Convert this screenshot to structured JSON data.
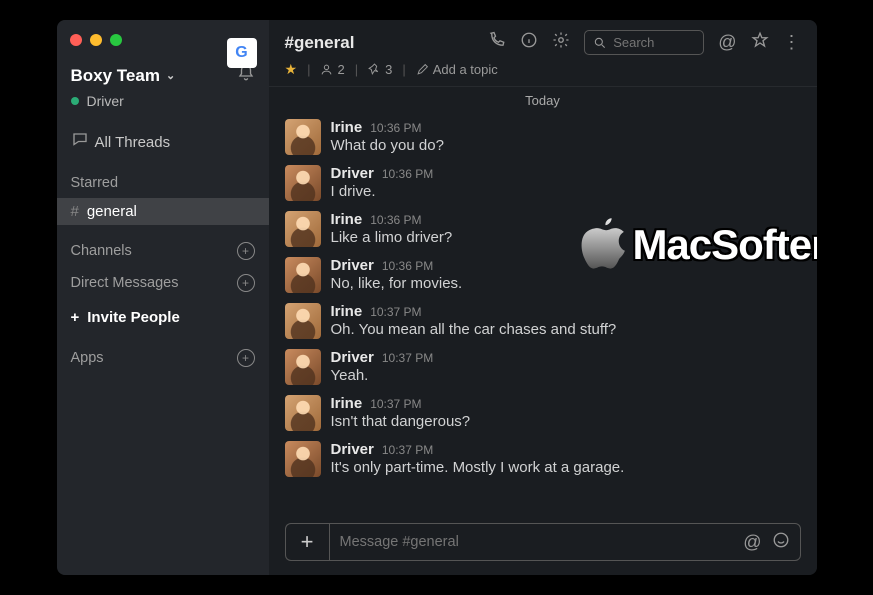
{
  "sidebar": {
    "team_name": "Boxy Team",
    "current_user": "Driver",
    "all_threads": "All Threads",
    "starred_label": "Starred",
    "channels_label": "Channels",
    "dm_label": "Direct Messages",
    "invite_label": "Invite People",
    "apps_label": "Apps",
    "starred_items": [
      {
        "name": "general",
        "active": true
      }
    ]
  },
  "header": {
    "channel_title": "#general",
    "members_count": "2",
    "pins_count": "3",
    "add_topic": "Add a topic",
    "search_placeholder": "Search"
  },
  "date_divider": "Today",
  "messages": [
    {
      "user": "Irine",
      "time": "10:36 PM",
      "text": "What do you do?"
    },
    {
      "user": "Driver",
      "time": "10:36 PM",
      "text": "I drive."
    },
    {
      "user": "Irine",
      "time": "10:36 PM",
      "text": "Like a limo driver?"
    },
    {
      "user": "Driver",
      "time": "10:36 PM",
      "text": "No, like, for movies."
    },
    {
      "user": "Irine",
      "time": "10:37 PM",
      "text": "Oh. You mean all the car chases and stuff?"
    },
    {
      "user": "Driver",
      "time": "10:37 PM",
      "text": "Yeah."
    },
    {
      "user": "Irine",
      "time": "10:37 PM",
      "text": "Isn't that dangerous?"
    },
    {
      "user": "Driver",
      "time": "10:37 PM",
      "text": "It's only part-time. Mostly I work at a garage."
    }
  ],
  "composer": {
    "placeholder": "Message #general"
  },
  "watermark": "MacSofter"
}
